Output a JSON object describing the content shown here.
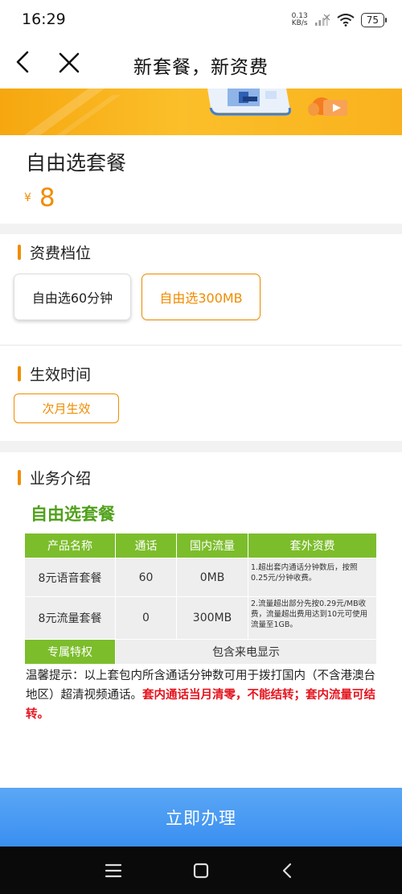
{
  "status_bar": {
    "time": "16:29",
    "net_speed_value": "0.13",
    "net_speed_unit": "KB/s",
    "battery": "75"
  },
  "nav": {
    "title": "新套餐，新资费",
    "back_icon": "back-arrow-icon",
    "close_icon": "close-icon"
  },
  "product": {
    "name": "自由选套餐",
    "currency": "¥",
    "price": "8"
  },
  "tariff": {
    "title": "资费档位",
    "options": [
      {
        "label": "自由选60分钟",
        "selected": false
      },
      {
        "label": "自由选300MB",
        "selected": true
      }
    ]
  },
  "effective": {
    "title": "生效时间",
    "option": "次月生效"
  },
  "intro": {
    "title": "业务介绍",
    "subtitle": "自由选套餐",
    "table": {
      "headers": [
        "产品名称",
        "通话",
        "国内流量",
        "套外资费"
      ],
      "rows": [
        [
          "8元语音套餐",
          "60",
          "0MB"
        ],
        [
          "8元流量套餐",
          "0",
          "300MB"
        ]
      ],
      "extra_fee": "1.超出套内通话分钟数后，按照0.25元/分钟收费。",
      "extra_fee2": "2.流量超出部分先按0.29元/MB收费，流量超出费用达到10元可使用流量至1GB。",
      "privilege_label": "专属特权",
      "privilege_value": "包含来电显示"
    },
    "tip_normal": "温馨提示：以上套包内所含通话分钟数可用于拨打国内（不含港澳台地区）超清视频通话。",
    "tip_red": "套内通话当月清零，不能结转；套内流量可结转。"
  },
  "cta": {
    "label": "立即办理"
  },
  "colors": {
    "accent": "#f08c00",
    "green": "#7cbd2c",
    "cta": "#3a8ff0",
    "red": "#e5141e"
  }
}
